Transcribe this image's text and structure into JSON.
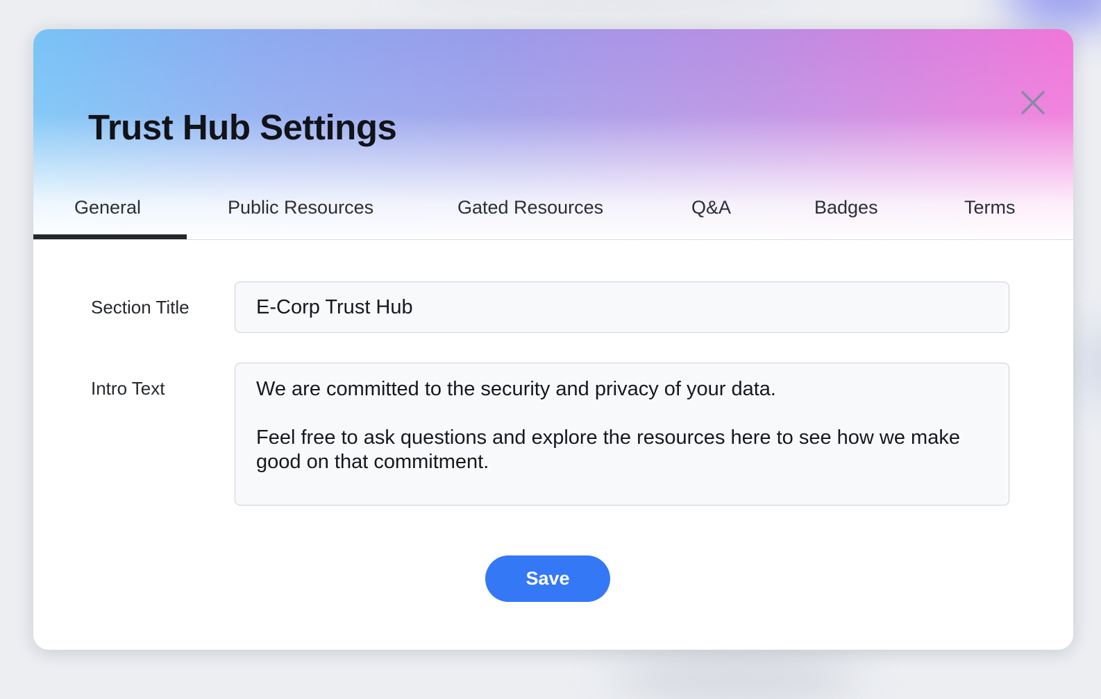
{
  "modal": {
    "title": "Trust Hub Settings",
    "close_icon": "close-icon"
  },
  "tabs": [
    {
      "label": "General",
      "active": true
    },
    {
      "label": "Public Resources",
      "active": false
    },
    {
      "label": "Gated Resources",
      "active": false
    },
    {
      "label": "Q&A",
      "active": false
    },
    {
      "label": "Badges",
      "active": false
    },
    {
      "label": "Terms",
      "active": false
    }
  ],
  "form": {
    "section_title": {
      "label": "Section Title",
      "value": "E-Corp Trust Hub"
    },
    "intro_text": {
      "label": "Intro Text",
      "value": "We are committed to the security and privacy of your data.\n\nFeel free to ask questions and explore the resources here to see how we make good on that commitment."
    }
  },
  "actions": {
    "save_label": "Save"
  },
  "colors": {
    "primary": "#3478f6",
    "active_tab_indicator": "#25272c",
    "header_gradient_start": "#77c3f6",
    "header_gradient_end": "#f176da"
  }
}
